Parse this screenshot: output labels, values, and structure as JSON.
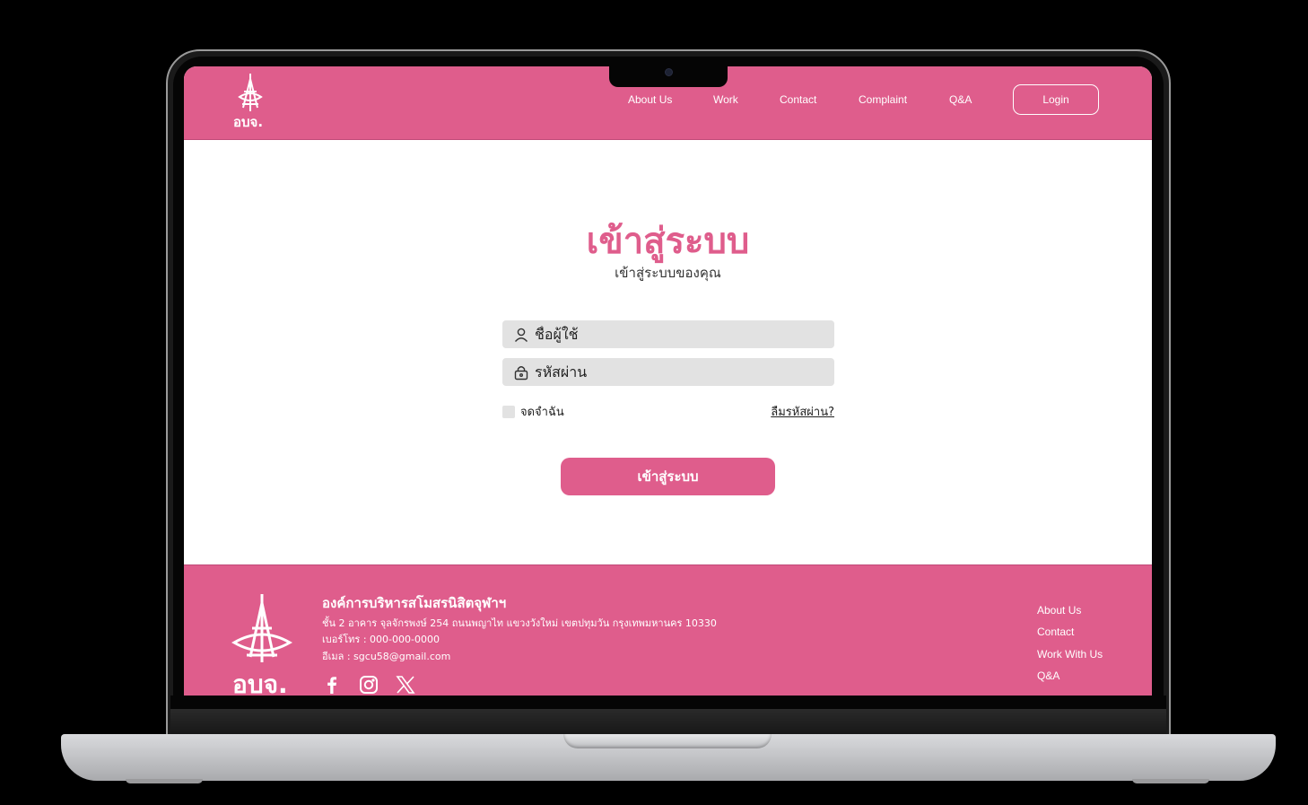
{
  "header": {
    "nav": [
      "About Us",
      "Work",
      "Contact",
      "Complaint",
      "Q&A"
    ],
    "login_label": "Login"
  },
  "login": {
    "title": "เข้าสู่ระบบ",
    "subtitle": "เข้าสู่ระบบของคุณ",
    "username_placeholder": "ชื่อผู้ใช้",
    "password_placeholder": "รหัสผ่าน",
    "remember_label": "จดจำฉัน",
    "forgot_label": "ลืมรหัสผ่าน?",
    "submit_label": "เข้าสู่ระบบ"
  },
  "footer": {
    "org_name": "องค์การบริหารสโมสรนิสิตจุฬาฯ",
    "address": "ชั้น 2 อาคาร จุลจักรพงษ์ 254 ถนนพญาไท แขวงวังใหม่ เขตปทุมวัน กรุงเทพมหานคร 10330",
    "phone": "เบอร์โทร :  000-000-0000",
    "email": "อีเมล : sgcu58@gmail.com",
    "links": [
      "About Us",
      "Contact",
      "Work With Us",
      "Q&A"
    ],
    "social_icons": [
      "facebook-icon",
      "instagram-icon",
      "x-icon"
    ]
  },
  "icons": [
    "logo-icon",
    "user-icon",
    "lock-icon"
  ],
  "colors": {
    "accent": "#df5d8c",
    "field_bg": "#e2e2e2"
  }
}
